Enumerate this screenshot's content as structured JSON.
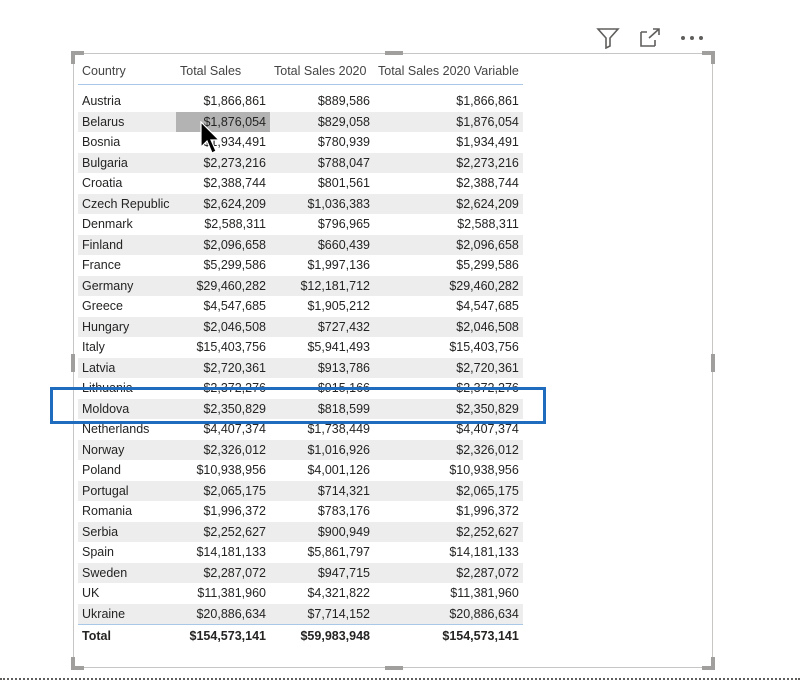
{
  "header": {
    "filter_icon": "filter-icon",
    "focus_icon": "focus-mode-icon",
    "more_icon": "more-options-icon"
  },
  "table": {
    "columns": [
      "Country",
      "Total Sales",
      "Total Sales 2020",
      "Total Sales 2020 Variable"
    ],
    "rows": [
      [
        "Austria",
        "$1,866,861",
        "$889,586",
        "$1,866,861"
      ],
      [
        "Belarus",
        "$1,876,054",
        "$829,058",
        "$1,876,054"
      ],
      [
        "Bosnia",
        "$1,934,491",
        "$780,939",
        "$1,934,491"
      ],
      [
        "Bulgaria",
        "$2,273,216",
        "$788,047",
        "$2,273,216"
      ],
      [
        "Croatia",
        "$2,388,744",
        "$801,561",
        "$2,388,744"
      ],
      [
        "Czech Republic",
        "$2,624,209",
        "$1,036,383",
        "$2,624,209"
      ],
      [
        "Denmark",
        "$2,588,311",
        "$796,965",
        "$2,588,311"
      ],
      [
        "Finland",
        "$2,096,658",
        "$660,439",
        "$2,096,658"
      ],
      [
        "France",
        "$5,299,586",
        "$1,997,136",
        "$5,299,586"
      ],
      [
        "Germany",
        "$29,460,282",
        "$12,181,712",
        "$29,460,282"
      ],
      [
        "Greece",
        "$4,547,685",
        "$1,905,212",
        "$4,547,685"
      ],
      [
        "Hungary",
        "$2,046,508",
        "$727,432",
        "$2,046,508"
      ],
      [
        "Italy",
        "$15,403,756",
        "$5,941,493",
        "$15,403,756"
      ],
      [
        "Latvia",
        "$2,720,361",
        "$913,786",
        "$2,720,361"
      ],
      [
        "Lithuania",
        "$2,372,276",
        "$915,166",
        "$2,372,276"
      ],
      [
        "Moldova",
        "$2,350,829",
        "$818,599",
        "$2,350,829"
      ],
      [
        "Netherlands",
        "$4,407,374",
        "$1,738,449",
        "$4,407,374"
      ],
      [
        "Norway",
        "$2,326,012",
        "$1,016,926",
        "$2,326,012"
      ],
      [
        "Poland",
        "$10,938,956",
        "$4,001,126",
        "$10,938,956"
      ],
      [
        "Portugal",
        "$2,065,175",
        "$714,321",
        "$2,065,175"
      ],
      [
        "Romania",
        "$1,996,372",
        "$783,176",
        "$1,996,372"
      ],
      [
        "Serbia",
        "$2,252,627",
        "$900,949",
        "$2,252,627"
      ],
      [
        "Spain",
        "$14,181,133",
        "$5,861,797",
        "$14,181,133"
      ],
      [
        "Sweden",
        "$2,287,072",
        "$947,715",
        "$2,287,072"
      ],
      [
        "UK",
        "$11,381,960",
        "$4,321,822",
        "$11,381,960"
      ],
      [
        "Ukraine",
        "$20,886,634",
        "$7,714,152",
        "$20,886,634"
      ]
    ],
    "total": [
      "Total",
      "$154,573,141",
      "$59,983,948",
      "$154,573,141"
    ],
    "highlighted_row": "Moldova",
    "hovered_cell": {
      "row": 1,
      "col": 1
    }
  },
  "colors": {
    "highlight_box": "#1f6bbd",
    "hover_cell": "#b3b3b3",
    "band": "#ededed"
  }
}
